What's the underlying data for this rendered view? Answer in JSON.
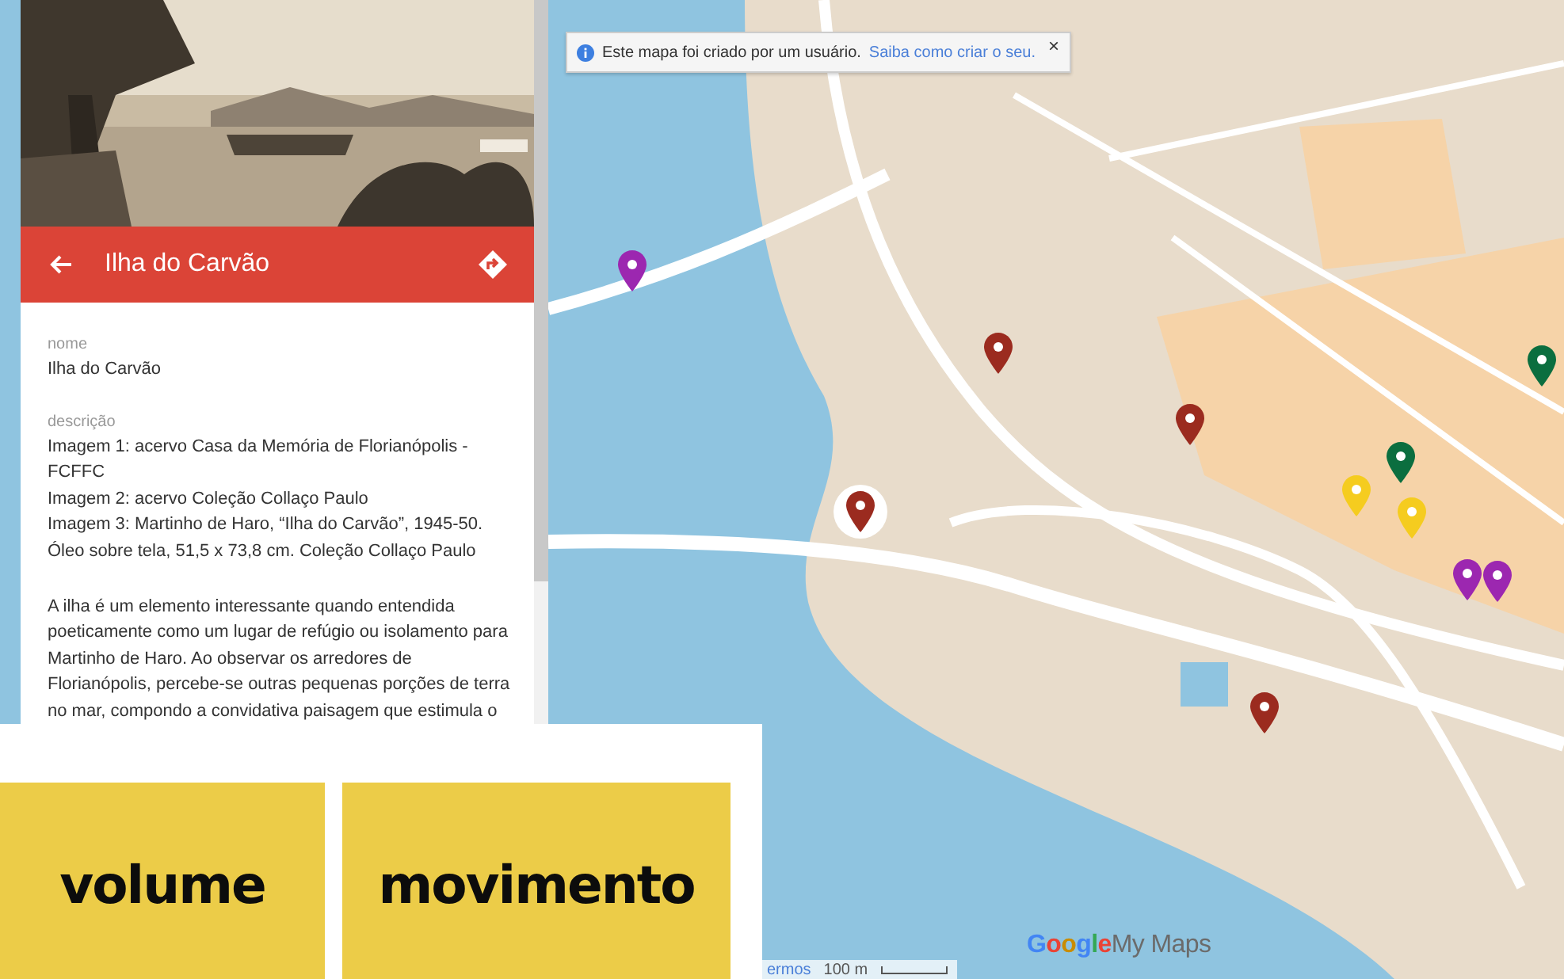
{
  "notice": {
    "text": "Este mapa foi criado por um usuário.",
    "link": "Saiba como criar o seu.",
    "close": "×"
  },
  "panel": {
    "title": "Ilha do Carvão",
    "fields": [
      {
        "label": "nome",
        "lines": [
          "Ilha do Carvão"
        ]
      },
      {
        "label": "descrição",
        "lines": [
          "Imagem 1: acervo Casa da Memória de Florianópolis - FCFFC",
          "Imagem 2: acervo Coleção Collaço Paulo",
          "Imagem 3: Martinho de Haro, “Ilha do Carvão”, 1945-50. Óleo sobre tela, 51,5 x 73,8 cm. Coleção Collaço Paulo"
        ]
      }
    ],
    "paragraph": "A ilha é um elemento interessante quando entendida poeticamente como um lugar de refúgio ou isolamento para Martinho de Haro. Ao observar os arredores de Florianópolis, percebe-se outras pequenas porções de terra no mar, compondo a convidativa paisagem que estimula o"
  },
  "markers": [
    {
      "color": "#9c27b0",
      "selected": false
    },
    {
      "color": "#9b2b1f",
      "selected": false
    },
    {
      "color": "#9b2b1f",
      "selected": false
    },
    {
      "color": "#9b2b1f",
      "selected": true
    },
    {
      "color": "#9b2b1f",
      "selected": false
    },
    {
      "color": "#0b6e3f",
      "selected": false
    },
    {
      "color": "#0b6e3f",
      "selected": false
    },
    {
      "color": "#f5cc1f",
      "selected": false
    },
    {
      "color": "#f5cc1f",
      "selected": false
    },
    {
      "color": "#9c27b0",
      "selected": false
    },
    {
      "color": "#9c27b0",
      "selected": false
    }
  ],
  "map_footer": {
    "terms": "ermos",
    "scale": "100 m",
    "logo_google": "Google",
    "logo_product": "My Maps"
  },
  "cards": [
    {
      "text": "volume"
    },
    {
      "text": "movimento"
    }
  ]
}
